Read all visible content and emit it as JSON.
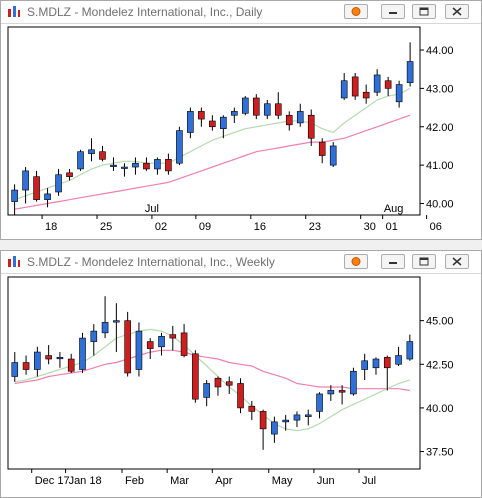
{
  "windows": [
    {
      "id": "daily",
      "title": "S.MDLZ - Mondelez International, Inc., Daily",
      "icons": [
        "app-chart-icon",
        "orange-dot-icon",
        "minimize-icon",
        "restore-icon",
        "close-icon"
      ]
    },
    {
      "id": "weekly",
      "title": "S.MDLZ - Mondelez International, Inc., Weekly",
      "icons": [
        "app-chart-icon",
        "orange-dot-icon",
        "minimize-icon",
        "restore-icon",
        "close-icon"
      ]
    }
  ],
  "colors": {
    "up": "#2f6fd6",
    "down": "#cc1f1f",
    "wick": "#000000",
    "ma_fast": "#b5dbb0",
    "ma_slow": "#f07fb0",
    "orange": "#ff7f0e"
  },
  "chart_data": [
    {
      "type": "candlestick",
      "title": "S.MDLZ - Mondelez International, Inc., Daily",
      "ylim": [
        39.7,
        44.6
      ],
      "yticks": [
        40.0,
        41.0,
        42.0,
        43.0,
        44.0
      ],
      "ytick_labels": [
        "40.00",
        "41.00",
        "42.00",
        "43.00",
        "44.00"
      ],
      "x_labels": [
        {
          "label": "18",
          "i": 3
        },
        {
          "label": "25",
          "i": 8
        },
        {
          "label": "02",
          "i": 13
        },
        {
          "label": "Jul",
          "i": 13,
          "upper": true
        },
        {
          "label": "09",
          "i": 17
        },
        {
          "label": "16",
          "i": 22
        },
        {
          "label": "23",
          "i": 27
        },
        {
          "label": "30",
          "i": 32
        },
        {
          "label": "01",
          "i": 34
        },
        {
          "label": "Aug",
          "i": 35,
          "upper": true
        },
        {
          "label": "06",
          "i": 38
        }
      ],
      "candles": [
        {
          "o": 40.05,
          "h": 40.5,
          "l": 39.7,
          "c": 40.35
        },
        {
          "o": 40.35,
          "h": 40.95,
          "l": 40.0,
          "c": 40.85
        },
        {
          "o": 40.7,
          "h": 40.85,
          "l": 40.05,
          "c": 40.1
        },
        {
          "o": 40.1,
          "h": 40.4,
          "l": 39.9,
          "c": 40.25
        },
        {
          "o": 40.3,
          "h": 40.9,
          "l": 40.2,
          "c": 40.75
        },
        {
          "o": 40.8,
          "h": 40.9,
          "l": 40.6,
          "c": 40.7
        },
        {
          "o": 40.9,
          "h": 41.4,
          "l": 40.85,
          "c": 41.35
        },
        {
          "o": 41.3,
          "h": 41.7,
          "l": 41.1,
          "c": 41.4
        },
        {
          "o": 41.35,
          "h": 41.5,
          "l": 41.1,
          "c": 41.15
        },
        {
          "o": 41.0,
          "h": 41.2,
          "l": 40.85,
          "c": 41.0
        },
        {
          "o": 40.95,
          "h": 41.05,
          "l": 40.7,
          "c": 40.95
        },
        {
          "o": 40.95,
          "h": 41.2,
          "l": 40.75,
          "c": 41.05
        },
        {
          "o": 41.05,
          "h": 41.2,
          "l": 40.85,
          "c": 40.9
        },
        {
          "o": 40.9,
          "h": 41.2,
          "l": 40.75,
          "c": 41.15
        },
        {
          "o": 41.15,
          "h": 41.3,
          "l": 40.75,
          "c": 40.85
        },
        {
          "o": 41.05,
          "h": 42.0,
          "l": 41.0,
          "c": 41.9
        },
        {
          "o": 41.85,
          "h": 42.5,
          "l": 41.7,
          "c": 42.4
        },
        {
          "o": 42.4,
          "h": 42.5,
          "l": 42.0,
          "c": 42.2
        },
        {
          "o": 42.15,
          "h": 42.3,
          "l": 41.9,
          "c": 42.0
        },
        {
          "o": 41.95,
          "h": 42.3,
          "l": 41.7,
          "c": 42.25
        },
        {
          "o": 42.3,
          "h": 42.5,
          "l": 42.1,
          "c": 42.4
        },
        {
          "o": 42.35,
          "h": 42.8,
          "l": 42.3,
          "c": 42.75
        },
        {
          "o": 42.75,
          "h": 42.85,
          "l": 42.2,
          "c": 42.3
        },
        {
          "o": 42.3,
          "h": 42.7,
          "l": 42.2,
          "c": 42.6
        },
        {
          "o": 42.6,
          "h": 42.9,
          "l": 42.2,
          "c": 42.3
        },
        {
          "o": 42.3,
          "h": 42.4,
          "l": 41.9,
          "c": 42.05
        },
        {
          "o": 42.1,
          "h": 42.6,
          "l": 42.0,
          "c": 42.4
        },
        {
          "o": 42.3,
          "h": 42.45,
          "l": 41.5,
          "c": 41.7
        },
        {
          "o": 41.6,
          "h": 41.7,
          "l": 41.05,
          "c": 41.25
        },
        {
          "o": 41.0,
          "h": 41.6,
          "l": 40.95,
          "c": 41.5
        },
        {
          "o": 42.75,
          "h": 43.4,
          "l": 42.7,
          "c": 43.2
        },
        {
          "o": 43.3,
          "h": 43.4,
          "l": 42.7,
          "c": 42.8
        },
        {
          "o": 42.9,
          "h": 43.1,
          "l": 42.6,
          "c": 42.75
        },
        {
          "o": 42.9,
          "h": 43.5,
          "l": 42.8,
          "c": 43.35
        },
        {
          "o": 43.2,
          "h": 43.3,
          "l": 42.8,
          "c": 43.0
        },
        {
          "o": 42.65,
          "h": 43.2,
          "l": 42.5,
          "c": 43.1
        },
        {
          "o": 43.15,
          "h": 44.2,
          "l": 43.05,
          "c": 43.7
        }
      ],
      "ma_fast": [
        40.1,
        40.2,
        40.3,
        40.4,
        40.5,
        40.6,
        40.75,
        40.9,
        41.0,
        41.05,
        41.1,
        41.1,
        41.05,
        41.05,
        41.05,
        41.2,
        41.35,
        41.5,
        41.65,
        41.75,
        41.85,
        41.95,
        42.0,
        42.05,
        42.1,
        42.15,
        42.15,
        42.1,
        41.95,
        41.85,
        42.1,
        42.3,
        42.5,
        42.7,
        42.8,
        42.85,
        43.0
      ],
      "ma_slow": [
        39.85,
        39.9,
        39.95,
        40.0,
        40.05,
        40.1,
        40.15,
        40.2,
        40.25,
        40.3,
        40.35,
        40.4,
        40.45,
        40.5,
        40.55,
        40.65,
        40.75,
        40.85,
        40.95,
        41.05,
        41.15,
        41.25,
        41.35,
        41.4,
        41.45,
        41.5,
        41.55,
        41.6,
        41.6,
        41.65,
        41.7,
        41.8,
        41.9,
        42.0,
        42.1,
        42.2,
        42.3
      ]
    },
    {
      "type": "candlestick",
      "title": "S.MDLZ - Mondelez International, Inc., Weekly",
      "ylim": [
        36.5,
        47.5
      ],
      "yticks": [
        37.5,
        40.0,
        42.5,
        45.0
      ],
      "ytick_labels": [
        "37.50",
        "40.00",
        "42.50",
        "45.00"
      ],
      "x_labels": [
        {
          "label": "Dec 17",
          "i": 2
        },
        {
          "label": "Jan 18",
          "i": 5
        },
        {
          "label": "Feb",
          "i": 10
        },
        {
          "label": "Mar",
          "i": 14
        },
        {
          "label": "Apr",
          "i": 18
        },
        {
          "label": "May",
          "i": 23
        },
        {
          "label": "Jun",
          "i": 27
        },
        {
          "label": "Jul",
          "i": 31
        }
      ],
      "candles": [
        {
          "o": 41.8,
          "h": 43.2,
          "l": 41.5,
          "c": 42.6
        },
        {
          "o": 42.6,
          "h": 43.0,
          "l": 41.9,
          "c": 42.2
        },
        {
          "o": 42.2,
          "h": 43.5,
          "l": 41.8,
          "c": 43.2
        },
        {
          "o": 43.0,
          "h": 43.6,
          "l": 42.5,
          "c": 42.8
        },
        {
          "o": 42.9,
          "h": 43.2,
          "l": 42.3,
          "c": 42.9
        },
        {
          "o": 42.8,
          "h": 43.1,
          "l": 42.0,
          "c": 42.1
        },
        {
          "o": 42.2,
          "h": 44.3,
          "l": 42.0,
          "c": 44.0
        },
        {
          "o": 43.8,
          "h": 44.8,
          "l": 43.0,
          "c": 44.4
        },
        {
          "o": 44.3,
          "h": 46.4,
          "l": 44.0,
          "c": 44.9
        },
        {
          "o": 45.0,
          "h": 46.0,
          "l": 43.2,
          "c": 45.0
        },
        {
          "o": 45.0,
          "h": 45.5,
          "l": 41.8,
          "c": 42.0
        },
        {
          "o": 42.2,
          "h": 44.9,
          "l": 41.8,
          "c": 44.4
        },
        {
          "o": 43.8,
          "h": 44.0,
          "l": 42.8,
          "c": 43.4
        },
        {
          "o": 43.5,
          "h": 44.3,
          "l": 43.0,
          "c": 44.1
        },
        {
          "o": 44.2,
          "h": 44.7,
          "l": 43.3,
          "c": 44.0
        },
        {
          "o": 44.3,
          "h": 44.8,
          "l": 42.9,
          "c": 43.0
        },
        {
          "o": 43.1,
          "h": 43.3,
          "l": 40.3,
          "c": 40.5
        },
        {
          "o": 40.6,
          "h": 41.6,
          "l": 40.1,
          "c": 41.4
        },
        {
          "o": 41.7,
          "h": 41.8,
          "l": 40.7,
          "c": 41.2
        },
        {
          "o": 41.5,
          "h": 41.8,
          "l": 40.8,
          "c": 41.3
        },
        {
          "o": 41.4,
          "h": 41.7,
          "l": 39.7,
          "c": 40.0
        },
        {
          "o": 40.1,
          "h": 40.4,
          "l": 39.3,
          "c": 39.8
        },
        {
          "o": 39.8,
          "h": 39.9,
          "l": 37.6,
          "c": 38.8
        },
        {
          "o": 38.5,
          "h": 39.5,
          "l": 38.0,
          "c": 39.2
        },
        {
          "o": 39.2,
          "h": 39.6,
          "l": 38.7,
          "c": 39.3
        },
        {
          "o": 39.3,
          "h": 39.8,
          "l": 38.9,
          "c": 39.6
        },
        {
          "o": 39.5,
          "h": 39.9,
          "l": 39.0,
          "c": 39.6
        },
        {
          "o": 39.8,
          "h": 40.9,
          "l": 39.4,
          "c": 40.8
        },
        {
          "o": 40.8,
          "h": 41.3,
          "l": 40.4,
          "c": 41.0
        },
        {
          "o": 41.0,
          "h": 41.3,
          "l": 40.2,
          "c": 40.9
        },
        {
          "o": 40.8,
          "h": 42.3,
          "l": 40.7,
          "c": 42.1
        },
        {
          "o": 42.2,
          "h": 43.1,
          "l": 41.6,
          "c": 42.7
        },
        {
          "o": 42.3,
          "h": 42.9,
          "l": 41.9,
          "c": 42.8
        },
        {
          "o": 42.9,
          "h": 43.0,
          "l": 41.0,
          "c": 42.3
        },
        {
          "o": 42.5,
          "h": 43.5,
          "l": 42.4,
          "c": 43.0
        },
        {
          "o": 42.8,
          "h": 44.2,
          "l": 42.7,
          "c": 43.8
        }
      ],
      "ma_fast": [
        41.5,
        41.6,
        41.8,
        42.0,
        42.2,
        42.4,
        42.6,
        43.0,
        43.5,
        44.0,
        44.2,
        44.4,
        44.5,
        44.4,
        44.1,
        43.6,
        43.0,
        42.4,
        41.8,
        41.2,
        40.7,
        40.1,
        39.6,
        39.1,
        38.8,
        38.7,
        38.8,
        39.1,
        39.5,
        39.9,
        40.2,
        40.5,
        40.8,
        41.1,
        41.4,
        41.6
      ],
      "ma_slow": [
        41.4,
        41.5,
        41.6,
        41.8,
        41.9,
        42.0,
        42.1,
        42.3,
        42.5,
        42.6,
        42.8,
        43.0,
        43.2,
        43.3,
        43.3,
        43.2,
        43.0,
        42.9,
        42.8,
        42.6,
        42.5,
        42.4,
        42.1,
        41.9,
        41.7,
        41.4,
        41.3,
        41.2,
        41.2,
        41.2,
        41.1,
        41.1,
        41.1,
        41.1,
        41.1,
        41.0
      ]
    }
  ]
}
